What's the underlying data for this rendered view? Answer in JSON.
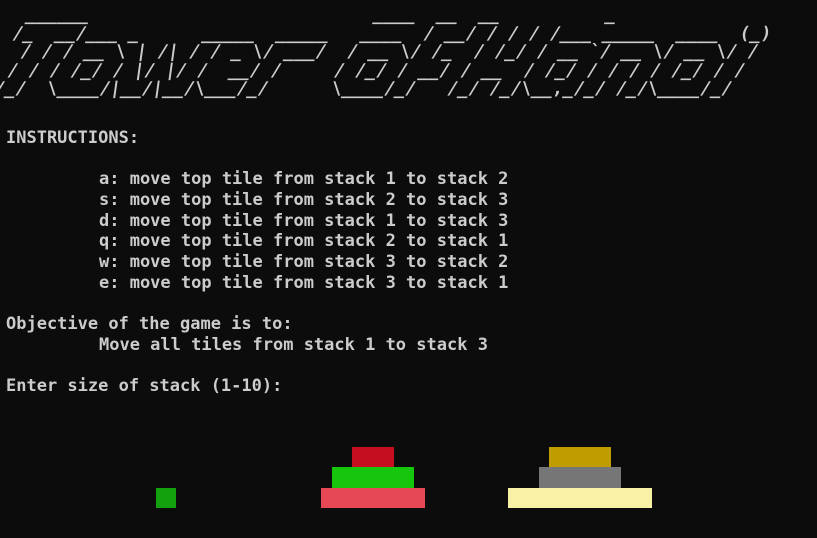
{
  "banner": {
    "lines": [
      "  ______                           ____  __  __          _",
      " /_  __/___ _      _____  _____   ____  / __/ / / / /___ _____  ____  (_)",
      "  / / / __ \\ | /| / / _ \\/ ___/  / __ \\/ /_  / /_/ / __ `/ __ \\/ __ \\/ /",
      " / / / /_/ / |/ |/ /  __/ /     / /_/ / __/ / __  / /_/ / / / / /_/ / /",
      "/_/  \\____/|__/|__/\\___/_/      \\____/_/   /_/ /_/\\__,_/_/ /_/\\____/_/"
    ],
    "title": "Tower of Hanoi"
  },
  "instructions": {
    "heading": "INSTRUCTIONS:",
    "items": [
      "a: move top tile from stack 1 to stack 2",
      "s: move top tile from stack 2 to stack 3",
      "d: move top tile from stack 1 to stack 3",
      "q: move top tile from stack 2 to stack 1",
      "w: move top tile from stack 3 to stack 2",
      "e: move top tile from stack 3 to stack 1"
    ]
  },
  "objective": {
    "heading": "Objective of the game is to:",
    "text": "Move all tiles from stack 1 to stack 3"
  },
  "prompt": {
    "text": "Enter size of stack (1-10):"
  },
  "stacks": [
    {
      "stack": 1,
      "tiles": [
        {
          "size": 1,
          "color": "#13a10e"
        }
      ]
    },
    {
      "stack": 2,
      "tiles": [
        {
          "size": 5,
          "color": "#e74856"
        },
        {
          "size": 4,
          "color": "#16c60c"
        },
        {
          "size": 2,
          "color": "#c50f1f"
        }
      ]
    },
    {
      "stack": 3,
      "tiles": [
        {
          "size": 7,
          "color": "#f9f1a5"
        },
        {
          "size": 4,
          "color": "#767676"
        },
        {
          "size": 3,
          "color": "#c19c00"
        }
      ]
    }
  ]
}
